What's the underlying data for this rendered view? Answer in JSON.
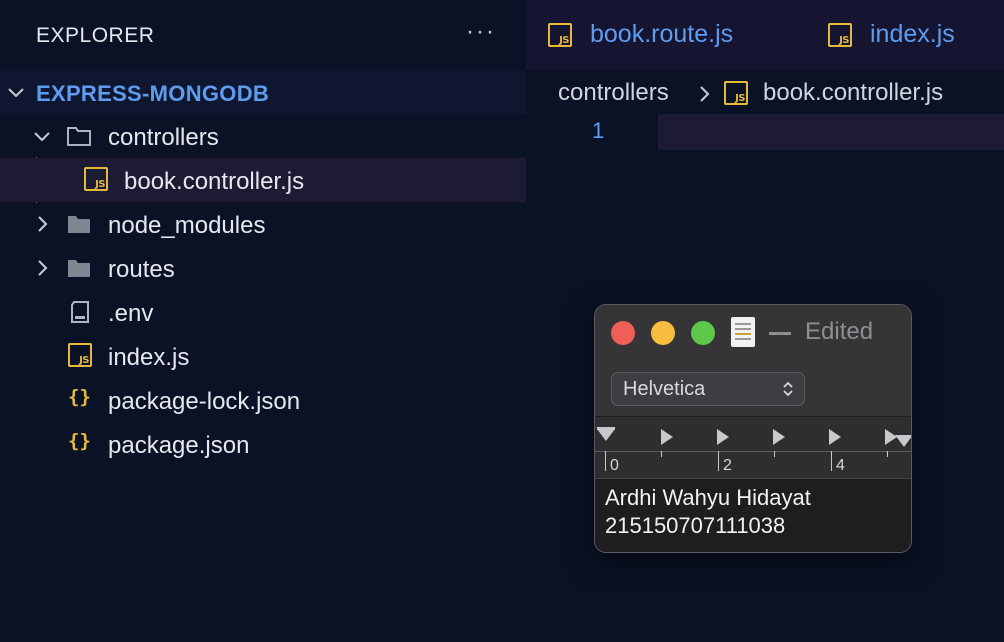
{
  "sidebar": {
    "title": "EXPLORER",
    "more_label": "···",
    "project_name": "EXPRESS-MONGODB",
    "items": [
      {
        "label": "controllers",
        "icon": "folder-open-icon"
      },
      {
        "label": "book.controller.js",
        "icon": "javascript-icon"
      },
      {
        "label": "node_modules",
        "icon": "folder-icon"
      },
      {
        "label": "routes",
        "icon": "folder-icon"
      },
      {
        "label": ".env",
        "icon": "file-icon"
      },
      {
        "label": "index.js",
        "icon": "javascript-icon"
      },
      {
        "label": "package-lock.json",
        "icon": "json-icon"
      },
      {
        "label": "package.json",
        "icon": "json-icon"
      }
    ]
  },
  "editor": {
    "tabs": [
      {
        "label": "book.route.js",
        "icon": "javascript-icon"
      },
      {
        "label": "index.js",
        "icon": "javascript-icon"
      }
    ],
    "breadcrumb": {
      "folder": "controllers",
      "file": "book.controller.js"
    },
    "line_number": "1"
  },
  "textedit": {
    "title": "Edited",
    "font": "Helvetica",
    "ruler_labels": [
      "0",
      "2",
      "4"
    ],
    "lines": [
      "Ardhi Wahyu Hidayat",
      "215150707111038"
    ]
  },
  "colors": {
    "background": "#0b1226",
    "accent_blue": "#5e9cf0",
    "js_yellow": "#e5b93a",
    "selection": "#1d1a33",
    "traffic_red": "#ee5f57",
    "traffic_yellow": "#f6bd3f",
    "traffic_green": "#5ec84a"
  }
}
